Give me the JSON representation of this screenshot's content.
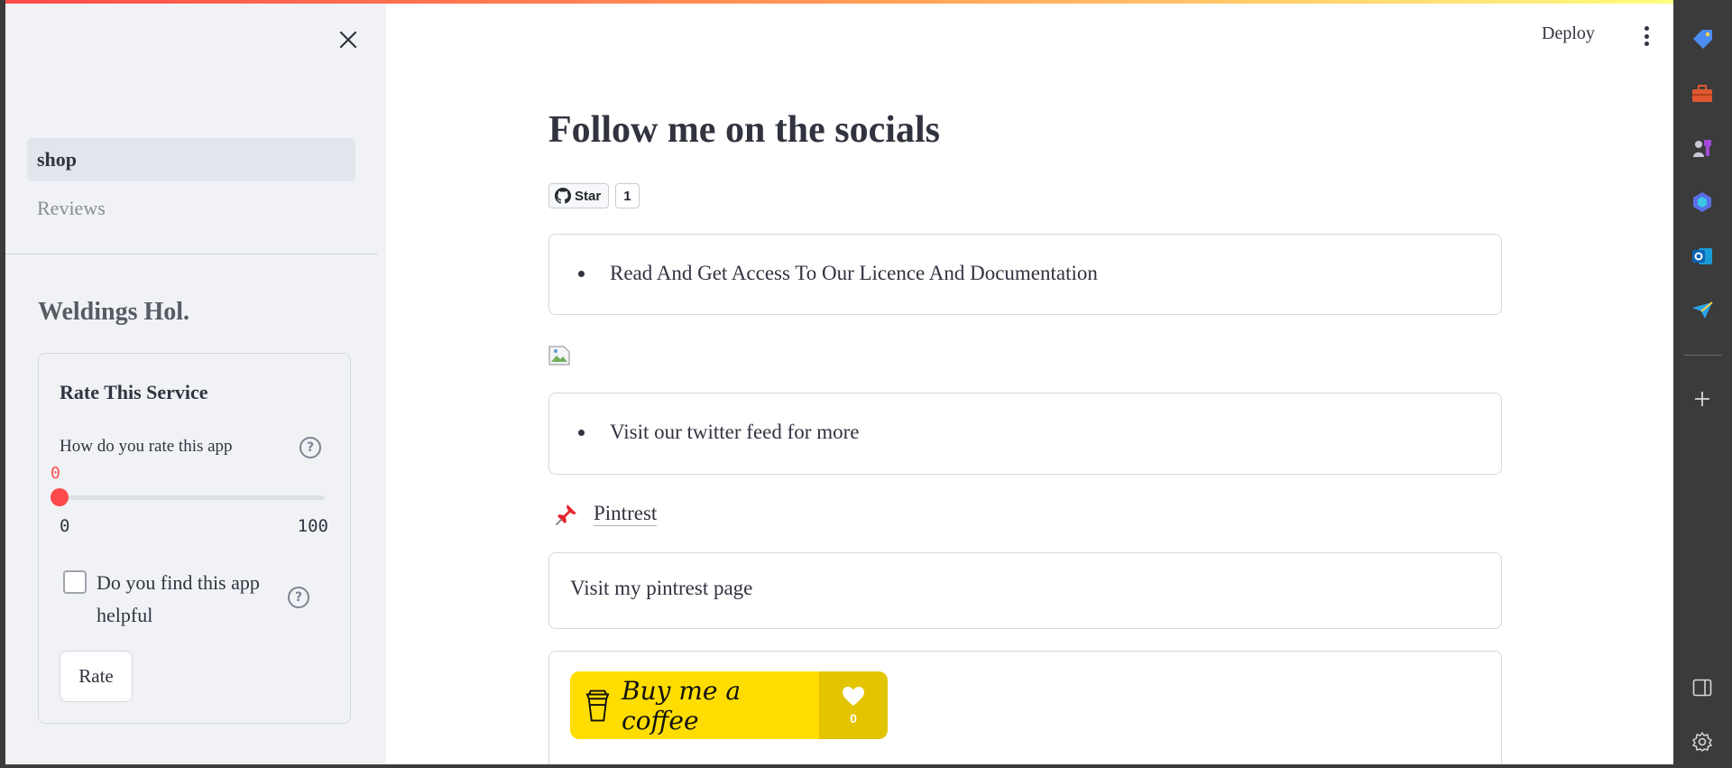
{
  "app": {
    "deploy_label": "Deploy",
    "accent_color": "#ff4b4b"
  },
  "sidebar": {
    "nav": [
      {
        "label": "shop",
        "active": true
      },
      {
        "label": "Reviews",
        "active": false
      }
    ],
    "brand": "Weldings Hol.",
    "rate_form": {
      "title": "Rate This Service",
      "question": "How do you rate this app",
      "slider": {
        "value": "0",
        "min": "0",
        "max": "100",
        "fraction": 0
      },
      "checkbox_label": "Do you find this app helpful",
      "checkbox_checked": false,
      "submit_label": "Rate"
    }
  },
  "main": {
    "title": "Follow me on the socials",
    "github": {
      "star_label": "Star",
      "count": "1"
    },
    "licence_item": "Read And Get Access To Our Licence And Documentation",
    "twitter_item": "Visit our twitter feed for more",
    "pintrest": {
      "icon": "pushpin-icon",
      "link": "Pintrest"
    },
    "pintrest_text": "Visit my pintrest page",
    "coffee": {
      "label": "Buy me a coffee",
      "count": "0",
      "color": "#ffdd00"
    }
  },
  "extensions": [
    "tag-icon",
    "toolbox-icon",
    "chess-icon",
    "copilot-icon",
    "outlook-icon",
    "send-icon",
    "plus-icon",
    "sidebar-toggle-icon",
    "settings-icon"
  ]
}
